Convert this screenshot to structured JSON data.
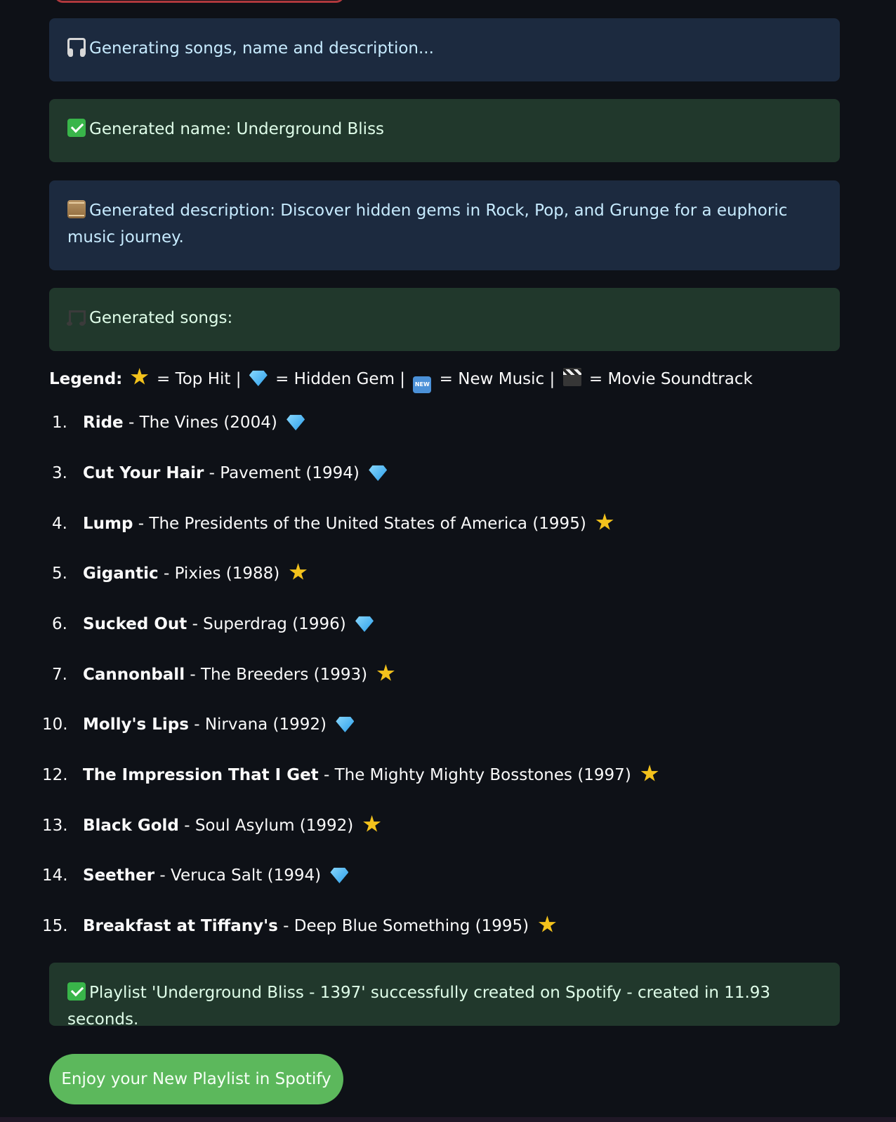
{
  "messages": {
    "generating": "Generating songs, name and description...",
    "name": "Generated name: Underground Bliss",
    "description": "Generated description: Discover hidden gems in Rock, Pop, and Grunge for a euphoric music journey.",
    "songs_heading": "Generated songs:",
    "success": "Playlist 'Underground Bliss - 1397' successfully created on Spotify - created in 11.93 seconds."
  },
  "legend": {
    "label": "Legend:",
    "top_hit": "= Top Hit |",
    "hidden_gem": "= Hidden Gem |",
    "new_music": "= New Music |",
    "movie_soundtrack": "= Movie Soundtrack",
    "new_badge": "NEW"
  },
  "songs": [
    {
      "num": "1.",
      "title": "Ride",
      "details": "- The Vines (2004)",
      "badge": "gem-icon"
    },
    {
      "num": "3.",
      "title": "Cut Your Hair",
      "details": "- Pavement (1994)",
      "badge": "gem-icon"
    },
    {
      "num": "4.",
      "title": "Lump",
      "details": "- The Presidents of the United States of America (1995)",
      "badge": "star-icon"
    },
    {
      "num": "5.",
      "title": "Gigantic",
      "details": "- Pixies (1988)",
      "badge": "star-icon"
    },
    {
      "num": "6.",
      "title": "Sucked Out",
      "details": "- Superdrag (1996)",
      "badge": "gem-icon"
    },
    {
      "num": "7.",
      "title": "Cannonball",
      "details": "- The Breeders (1993)",
      "badge": "star-icon"
    },
    {
      "num": "10.",
      "title": "Molly's Lips",
      "details": "- Nirvana (1992)",
      "badge": "gem-icon"
    },
    {
      "num": "12.",
      "title": "The Impression That I Get",
      "details": "- The Mighty Mighty Bosstones (1997)",
      "badge": "star-icon"
    },
    {
      "num": "13.",
      "title": "Black Gold",
      "details": "- Soul Asylum (1992)",
      "badge": "star-icon"
    },
    {
      "num": "14.",
      "title": "Seether",
      "details": "- Veruca Salt (1994)",
      "badge": "gem-icon"
    },
    {
      "num": "15.",
      "title": "Breakfast at Tiffany's",
      "details": "- Deep Blue Something (1995)",
      "badge": "star-icon"
    }
  ],
  "button": {
    "open_spotify": "Enjoy your New Playlist in Spotify"
  },
  "colors": {
    "background": "#0e1117",
    "info_bg": "#1c2a3f",
    "success_bg": "#21382c",
    "button_green": "#5cb85c",
    "top_button_red": "#b0383d"
  }
}
